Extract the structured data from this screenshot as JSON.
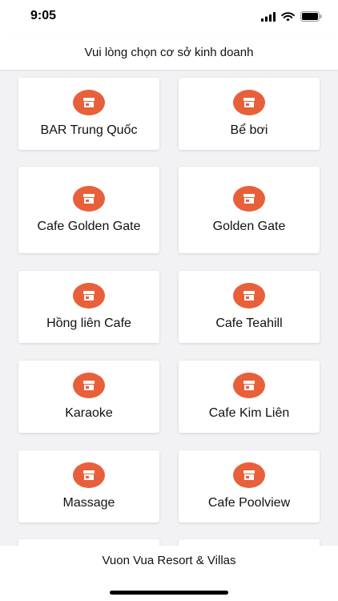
{
  "status_bar": {
    "time": "9:05",
    "icons": [
      "signal-icon",
      "wifi-icon",
      "battery-icon"
    ]
  },
  "header": {
    "title": "Vui lòng chọn cơ sở kinh doanh"
  },
  "businesses": [
    {
      "label": "BAR Trung Quốc",
      "icon": "store-icon"
    },
    {
      "label": "Bể bơi",
      "icon": "store-icon"
    },
    {
      "label": "Cafe Golden Gate",
      "icon": "store-icon"
    },
    {
      "label": "Golden Gate",
      "icon": "store-icon"
    },
    {
      "label": "Hồng liên Cafe",
      "icon": "store-icon"
    },
    {
      "label": "Cafe Teahill",
      "icon": "store-icon"
    },
    {
      "label": "Karaoke",
      "icon": "store-icon"
    },
    {
      "label": "Cafe Kim Liên",
      "icon": "store-icon"
    },
    {
      "label": "Massage",
      "icon": "store-icon"
    },
    {
      "label": "Cafe Poolview",
      "icon": "store-icon"
    },
    {
      "label": "",
      "icon": ""
    },
    {
      "label": "",
      "icon": ""
    }
  ],
  "footer": {
    "label": "Vuon Vua Resort & Villas"
  },
  "colors": {
    "accent": "#e8603a",
    "background": "#f2f2f4",
    "card": "#ffffff"
  }
}
